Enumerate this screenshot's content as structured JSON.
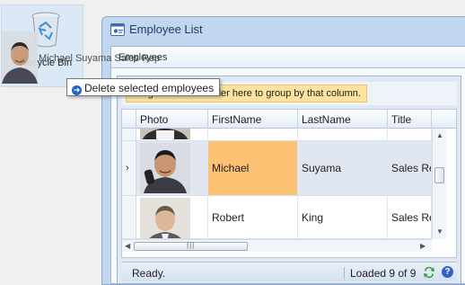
{
  "desktop": {
    "recycle_bin_label": "Recycle Bin"
  },
  "drag": {
    "label": "Michael Suyama Sales Rep"
  },
  "tooltip": {
    "label": "Delete selected employees"
  },
  "window": {
    "title": "Employee List",
    "tab_label": "Employees",
    "group_hint": "Drag a column header here to group by that column."
  },
  "grid": {
    "columns": [
      "Photo",
      "FirstName",
      "LastName",
      "Title"
    ],
    "rows": [
      {
        "first_name": "Michael",
        "last_name": "Suyama",
        "title": "Sales Representative",
        "selected": true,
        "current_cell": "FirstName"
      },
      {
        "first_name": "Robert",
        "last_name": "King",
        "title": "Sales Representative",
        "selected": false
      }
    ],
    "current_row_indicator": "›"
  },
  "status": {
    "text": "Ready.",
    "count": "Loaded 9 of 9"
  },
  "colors": {
    "accent": "#fcc173",
    "selection": "#e1e7f0",
    "frame": "#c2d6ef",
    "hint": "#fde3a0"
  },
  "icons": [
    "recycle-bin-icon",
    "window-app-icon",
    "refresh-icon",
    "help-icon",
    "arrow-right-icon"
  ]
}
